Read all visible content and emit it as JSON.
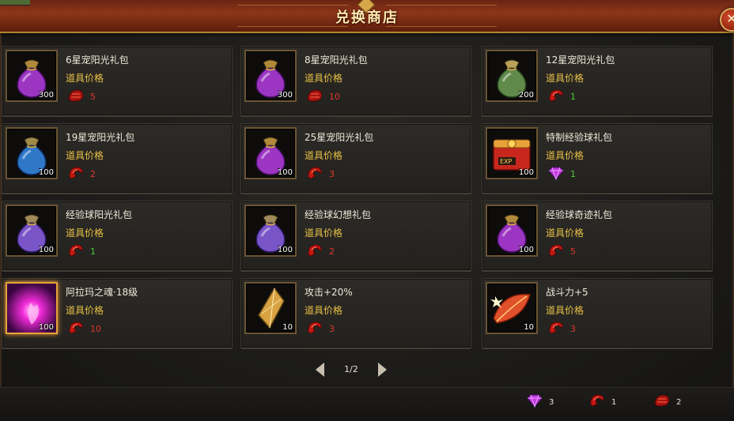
{
  "window": {
    "title": "兑换商店",
    "close_label": "✕"
  },
  "price_label": "道具价格",
  "items": [
    {
      "name": "6星宠阳光礼包",
      "count": "300",
      "price": "5",
      "currency": "red-crystal",
      "icon": "purple-pouch-icon"
    },
    {
      "name": "8星宠阳光礼包",
      "count": "300",
      "price": "10",
      "currency": "red-crystal",
      "icon": "purple-pouch-icon"
    },
    {
      "name": "12星宠阳光礼包",
      "count": "200",
      "price": "1",
      "currency": "red-shard",
      "icon": "green-pouch-icon"
    },
    {
      "name": "19星宠阳光礼包",
      "count": "100",
      "price": "2",
      "currency": "red-shard",
      "icon": "blue-pouch-icon"
    },
    {
      "name": "25星宠阳光礼包",
      "count": "100",
      "price": "3",
      "currency": "red-shard",
      "icon": "purple-pouch-icon"
    },
    {
      "name": "特制经验球礼包",
      "count": "100",
      "price": "1",
      "currency": "purple-gem",
      "icon": "exp-chest-icon"
    },
    {
      "name": "经验球阳光礼包",
      "count": "100",
      "price": "1",
      "currency": "red-shard",
      "icon": "violet-pouch-icon"
    },
    {
      "name": "经验球幻想礼包",
      "count": "100",
      "price": "2",
      "currency": "red-shard",
      "icon": "violet-pouch-icon"
    },
    {
      "name": "经验球奇迹礼包",
      "count": "100",
      "price": "5",
      "currency": "red-shard",
      "icon": "purple-pouch-icon"
    },
    {
      "name": "阿拉玛之魂·18级",
      "count": "100",
      "price": "10",
      "currency": "red-shard",
      "icon": "soul-orb-icon"
    },
    {
      "name": "攻击+20%",
      "count": "10",
      "price": "3",
      "currency": "red-shard",
      "icon": "gold-crystal-icon"
    },
    {
      "name": "战斗力+5",
      "count": "10",
      "price": "3",
      "currency": "red-shard",
      "icon": "fire-leaf-icon"
    }
  ],
  "pager": {
    "indicator": "1/2"
  },
  "wallet": [
    {
      "currency": "purple-gem",
      "amount": "3"
    },
    {
      "currency": "red-shard",
      "amount": "1"
    },
    {
      "currency": "red-crystal",
      "amount": "2"
    }
  ],
  "colors": {
    "price_label": "#e8c146",
    "price_red": "#e0382a",
    "price_green": "#4fcc3a",
    "title": "#ffe9b0",
    "titlebar": "#8d3619"
  }
}
